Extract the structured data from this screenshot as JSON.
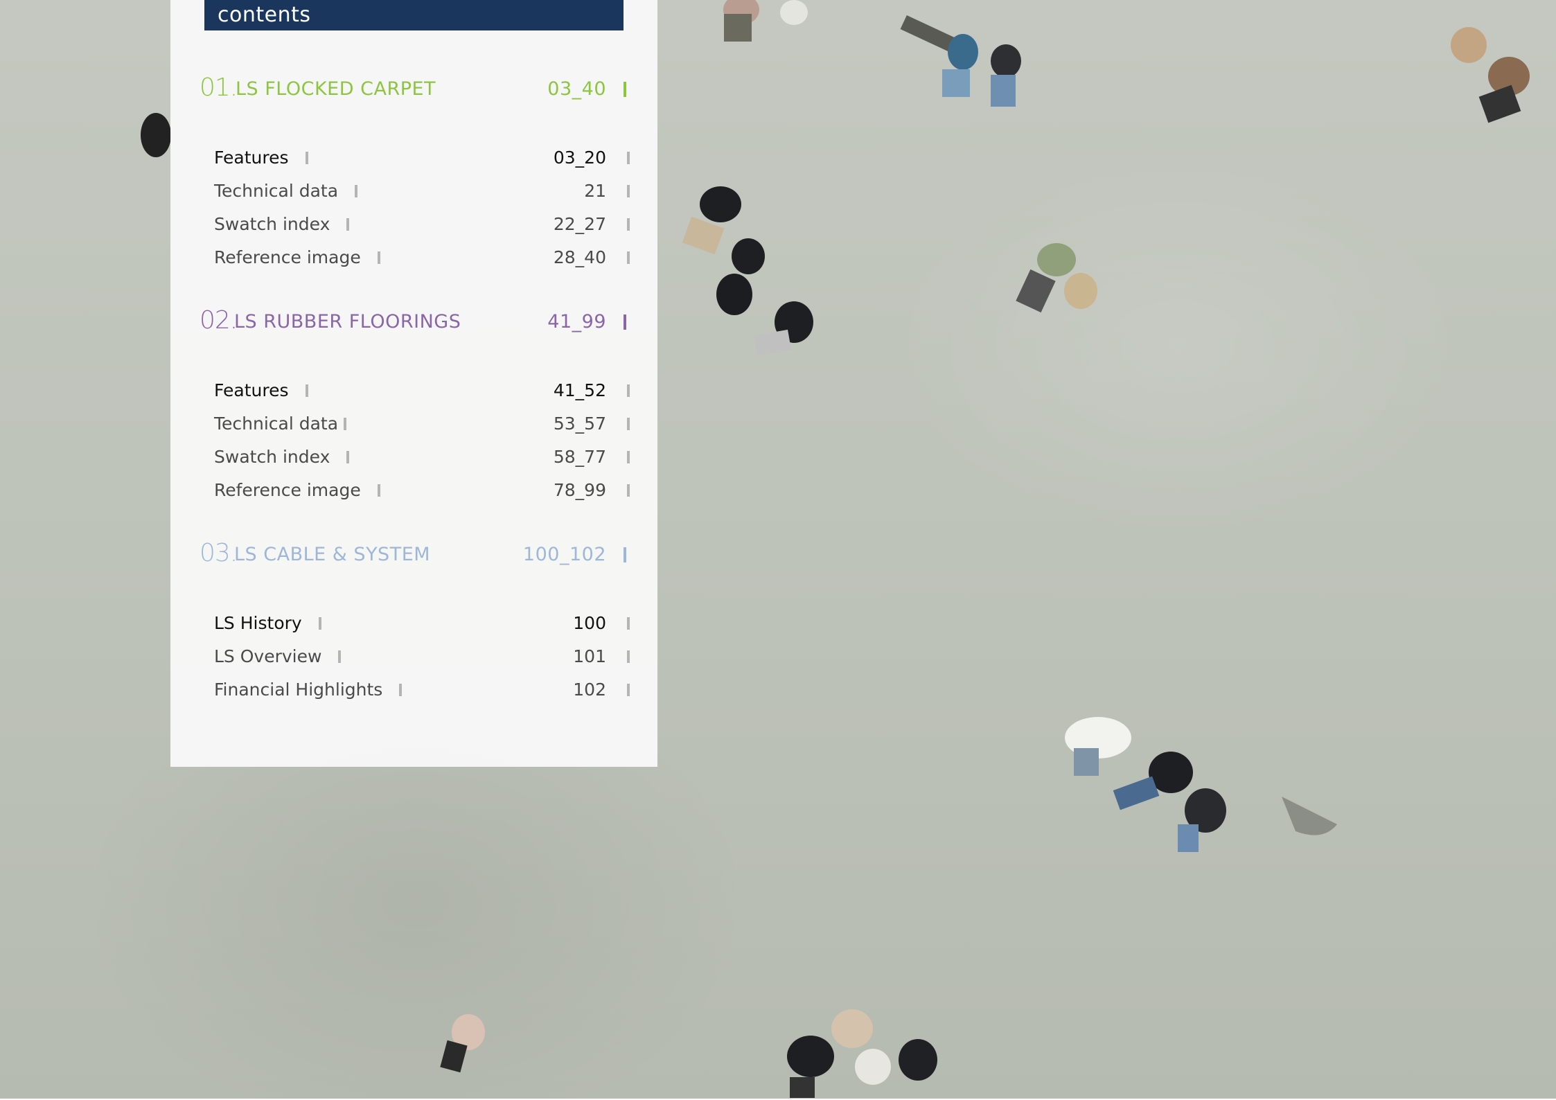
{
  "header": {
    "title": "contents"
  },
  "sections": [
    {
      "number": "01.",
      "title": "LS FLOCKED CARPET",
      "pages": "03_40",
      "color": "#8cc63f",
      "items": [
        {
          "label": "Features",
          "pages": "03_20"
        },
        {
          "label": "Technical data",
          "pages": "21"
        },
        {
          "label": "Swatch index",
          "pages": "22_27"
        },
        {
          "label": "Reference image",
          "pages": "28_40"
        }
      ]
    },
    {
      "number": "02.",
      "title": "LS RUBBER FLOORINGS",
      "pages": "41_99",
      "color": "#8a65a8",
      "items": [
        {
          "label": "Features",
          "pages": "41_52"
        },
        {
          "label": "Technical data",
          "pages": "53_57"
        },
        {
          "label": "Swatch index",
          "pages": "58_77"
        },
        {
          "label": "Reference image",
          "pages": "78_99"
        }
      ]
    },
    {
      "number": "03.",
      "title": "LS CABLE & SYSTEM",
      "pages": "100_102",
      "color": "#9db7d9",
      "items": [
        {
          "label": "LS History",
          "pages": "100"
        },
        {
          "label": "LS Overview",
          "pages": "101"
        },
        {
          "label": "Financial Highlights",
          "pages": "102"
        }
      ]
    }
  ],
  "colors": {
    "header_bar": "#1b365d",
    "panel": "#fafafa",
    "background_photo": "#c0c4bc"
  }
}
